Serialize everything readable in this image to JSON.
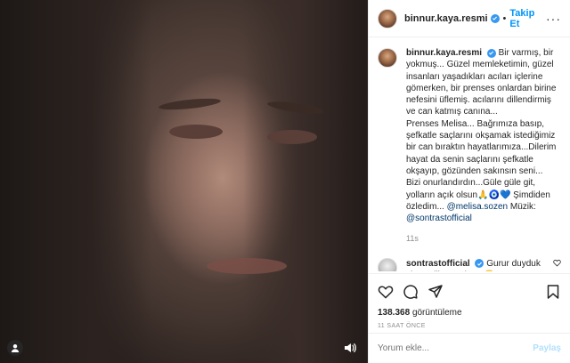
{
  "header": {
    "username": "binnur.kaya.resmi",
    "separator": "•",
    "follow_label": "Takip Et",
    "more_label": "···"
  },
  "caption": {
    "username": "binnur.kaya.resmi",
    "text_1": "Bir varmış, bir yokmuş... Güzel memleketimin, güzel insanları yaşadıkları acıları içlerine gömerken, bir prenses onlardan birine nefesini üflemiş. acılarını dillendirmiş ve can katmış canına...",
    "text_2": "Prenses Melisa... Bağrımıza basıp, şefkatle saçlarını okşamak istediğimiz bir can bıraktın hayatlarımıza...Dilerim hayat da senin saçlarını şefkatle okşayıp, gözünden sakınsın seni... Bizi onurlandırdın...Güle güle git, yolların açık olsun🙏🧿💙 Şimdiden özledim...",
    "mention_1": "@melisa.sozen",
    "music_label": "Müzik:",
    "mention_2": "@sontrastofficial",
    "time": "11s"
  },
  "comment": {
    "username": "sontrastofficial",
    "text": "Gurur duyduk size eşlik etmekten 😊"
  },
  "actions": {
    "views_count": "138.368",
    "views_label": "görüntüleme",
    "posted_ago": "11 SAAT ÖNCE"
  },
  "add_comment": {
    "placeholder": "Yorum ekle...",
    "post_label": "Paylaş"
  },
  "colors": {
    "accent": "#0095f6",
    "verified": "#3897f0",
    "link": "#00376b",
    "muted": "#8e8e8e",
    "post_disabled": "#b2dffc"
  }
}
